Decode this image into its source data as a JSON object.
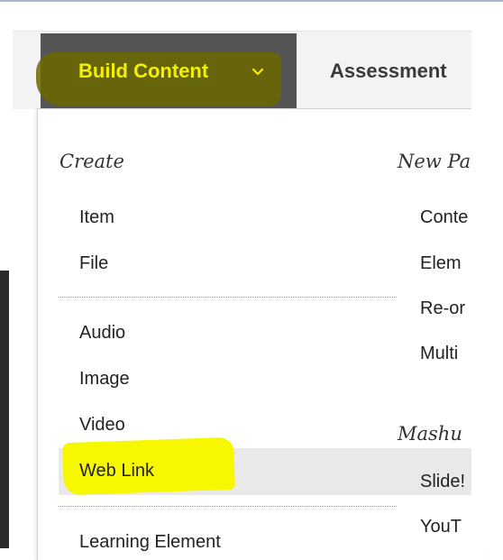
{
  "toolbar": {
    "build_content_label": "Build Content",
    "assessments_label": "Assessment"
  },
  "menu": {
    "create_title": "Create",
    "new_page_title": "New Pa",
    "mashups_title": "Mashu",
    "create_items": [
      "Item",
      "File",
      "Audio",
      "Image",
      "Video",
      "Web Link",
      "Learning Element"
    ],
    "right_items": [
      "Conte",
      "Elem",
      "Re-or",
      "Multi",
      "Slide!",
      "YouT"
    ]
  },
  "colors": {
    "highlight": "#f7f700",
    "tab_bg": "#555555",
    "hover_row": "#e9e9e9"
  }
}
